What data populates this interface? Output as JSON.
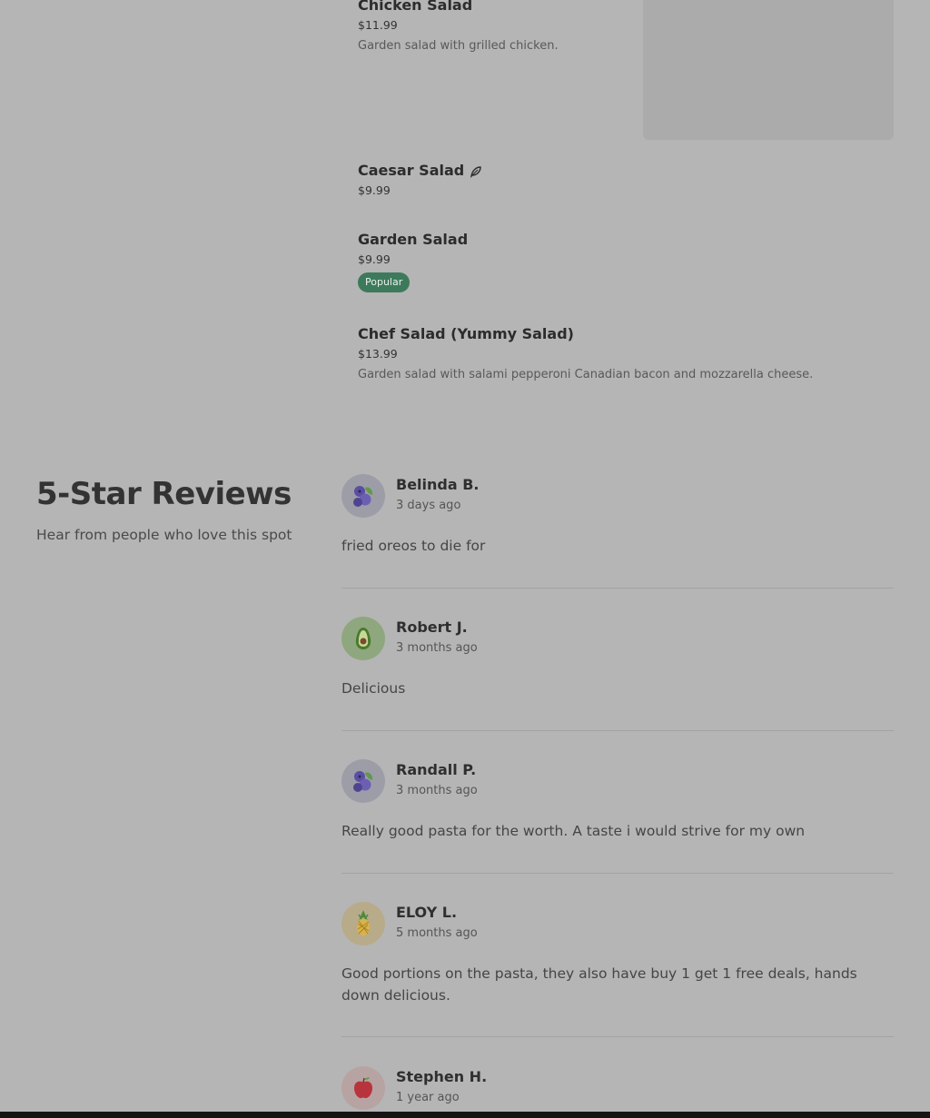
{
  "menu": {
    "items": [
      {
        "name": "Chicken Salad",
        "price": "$11.99",
        "description": "Garden salad with grilled chicken."
      },
      {
        "name": "Caesar Salad",
        "price": "$9.99",
        "icon": "leaf-icon"
      },
      {
        "name": "Garden Salad",
        "price": "$9.99",
        "badge": "Popular"
      },
      {
        "name": "Chef Salad (Yummy Salad)",
        "price": "$13.99",
        "description": "Garden salad with salami pepperoni Canadian bacon and mozzarella cheese."
      }
    ]
  },
  "reviews_section": {
    "title": "5-Star Reviews",
    "subtitle": "Hear from people who love this spot",
    "reviews": [
      {
        "name": "Belinda B.",
        "time": "3 days ago",
        "text": "fried oreos to die for",
        "avatar": "blueberry-icon"
      },
      {
        "name": "Robert J.",
        "time": "3 months ago",
        "text": "Delicious",
        "avatar": "avocado-icon"
      },
      {
        "name": "Randall P.",
        "time": "3 months ago",
        "text": "Really good pasta for the worth. A taste i would strive for my own",
        "avatar": "blueberry-icon"
      },
      {
        "name": "ELOY L.",
        "time": "5 months ago",
        "text": "Good portions on the pasta, they also have buy 1 get 1 free deals, hands down delicious.",
        "avatar": "pineapple-icon"
      },
      {
        "name": "Stephen H.",
        "time": "1 year ago",
        "text": "",
        "avatar": "apple-icon"
      }
    ]
  },
  "colors": {
    "background": "#b5b5b5",
    "badge": "#3d7a5c",
    "avatar_blueberry": "#9d9da8",
    "avatar_avocado": "#8ea77e",
    "avatar_pineapple": "#b8ab8a",
    "avatar_apple": "#b8a3a3"
  }
}
